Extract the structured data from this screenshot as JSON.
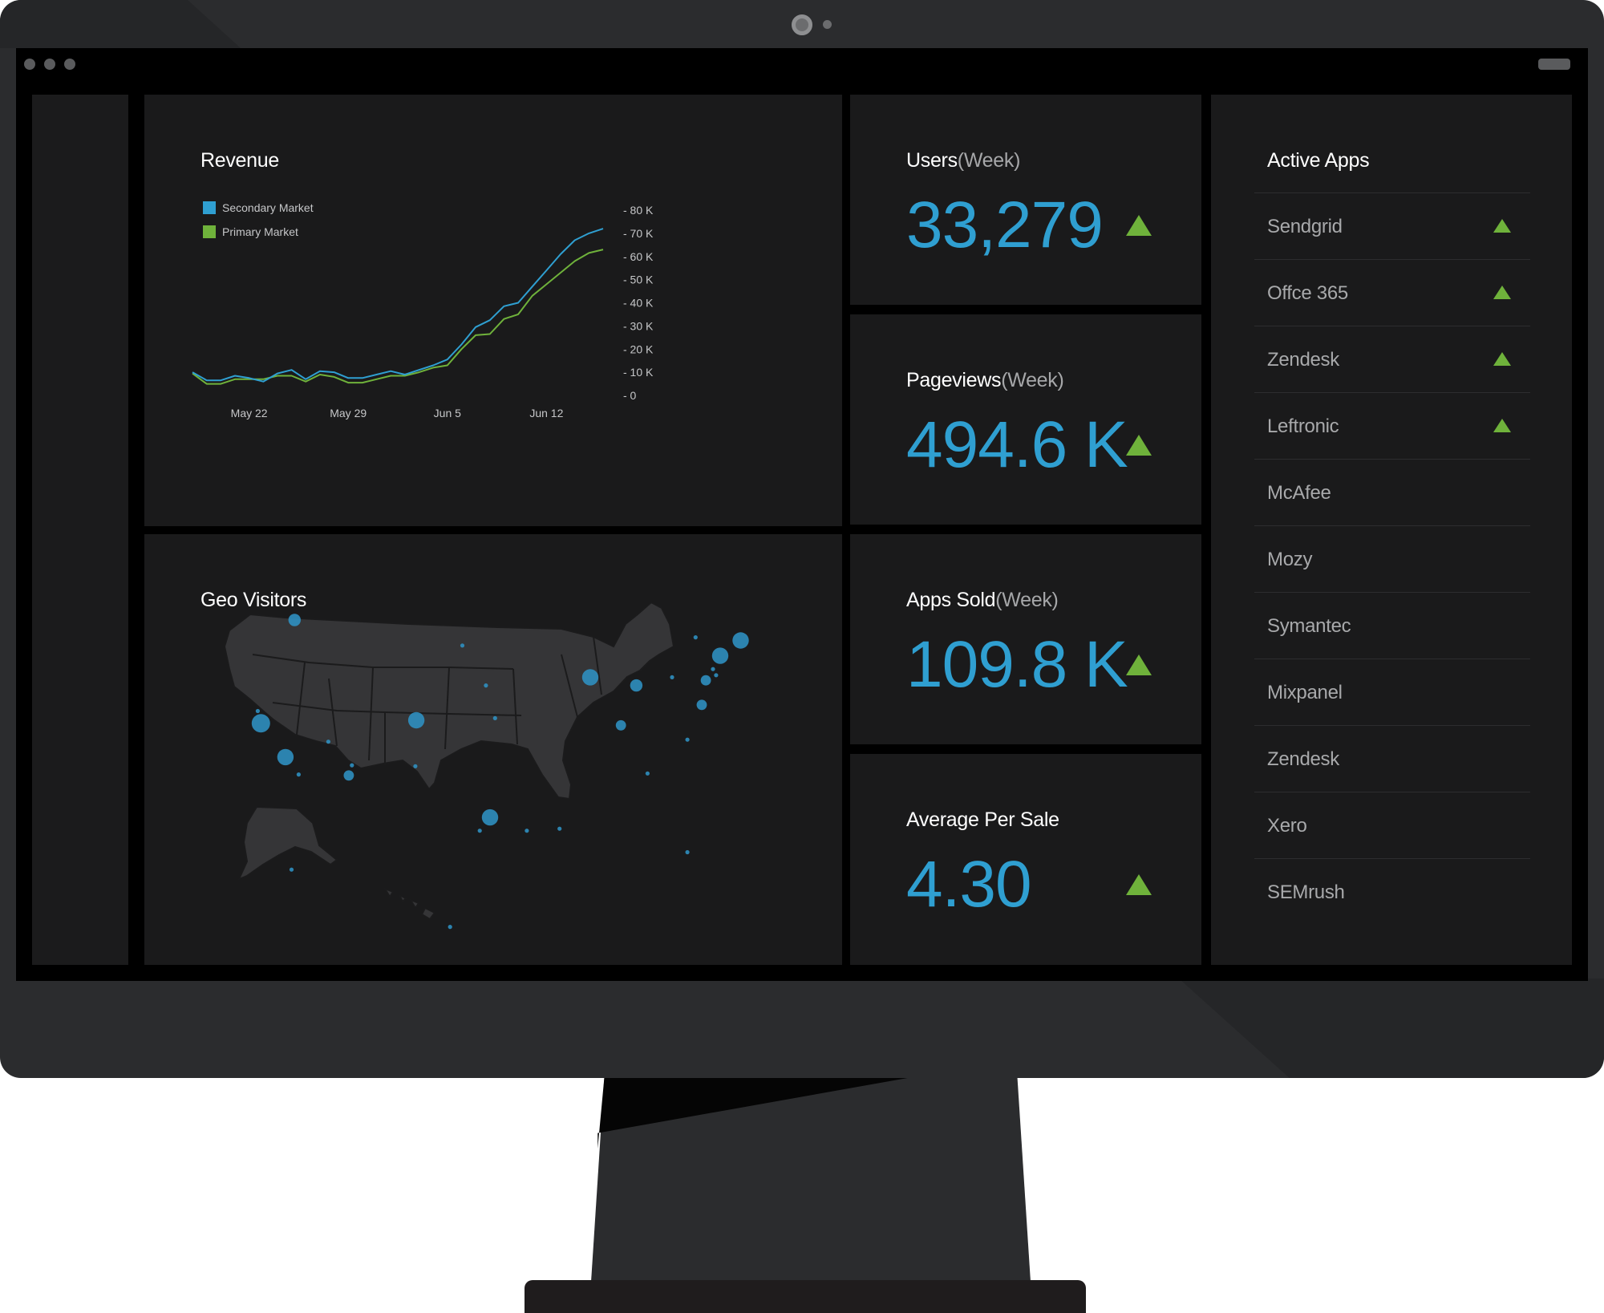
{
  "revenue": {
    "title": "Revenue",
    "legend": [
      {
        "label": "Secondary Market",
        "color": "#2f9fd1"
      },
      {
        "label": "Primary Market",
        "color": "#6fb23b"
      }
    ]
  },
  "chart_data": {
    "type": "line",
    "title": "Revenue",
    "x_ticks": [
      "May 22",
      "May 29",
      "Jun 5",
      "Jun 12"
    ],
    "y_ticks": [
      "- 80 K",
      "- 70 K",
      "- 60 K",
      "- 50 K",
      "- 40 K",
      "- 30 K",
      "- 20 K",
      "- 10 K",
      "- 0"
    ],
    "ylim": [
      0,
      80000
    ],
    "grid": false,
    "legend_position": "top-left",
    "x": [
      "May 18",
      "May 19",
      "May 20",
      "May 21",
      "May 22",
      "May 23",
      "May 24",
      "May 25",
      "May 26",
      "May 27",
      "May 28",
      "May 29",
      "May 30",
      "May 31",
      "Jun 1",
      "Jun 2",
      "Jun 3",
      "Jun 4",
      "Jun 5",
      "Jun 6",
      "Jun 7",
      "Jun 8",
      "Jun 9",
      "Jun 10",
      "Jun 11",
      "Jun 12",
      "Jun 13",
      "Jun 14",
      "Jun 15",
      "Jun 16"
    ],
    "series": [
      {
        "name": "Secondary Market",
        "color": "#2f9fd1",
        "values": [
          10000,
          6500,
          6500,
          8500,
          7500,
          6000,
          9500,
          11000,
          7000,
          10500,
          10000,
          7500,
          7500,
          9000,
          10500,
          9000,
          11000,
          13000,
          15500,
          22000,
          29500,
          32500,
          38500,
          40000,
          47000,
          54000,
          61000,
          67000,
          70000,
          72000
        ]
      },
      {
        "name": "Primary Market",
        "color": "#6fb23b",
        "values": [
          9500,
          5000,
          5000,
          7000,
          7000,
          7000,
          8500,
          8500,
          6000,
          9000,
          8000,
          5500,
          5500,
          7000,
          8500,
          8500,
          10000,
          12000,
          13000,
          20000,
          26000,
          26500,
          33000,
          35000,
          43000,
          48000,
          53000,
          58000,
          61500,
          63000
        ]
      }
    ]
  },
  "geo": {
    "title": "Geo Visitors",
    "bubbles": [
      {
        "x": 288,
        "y": 606,
        "r": 6
      },
      {
        "x": 255,
        "y": 707,
        "r": 9
      },
      {
        "x": 279,
        "y": 740,
        "r": 8
      },
      {
        "x": 407,
        "y": 704,
        "r": 8
      },
      {
        "x": 577,
        "y": 662,
        "r": 8
      },
      {
        "x": 622,
        "y": 670,
        "r": 6
      },
      {
        "x": 607,
        "y": 709,
        "r": 5
      },
      {
        "x": 704,
        "y": 641,
        "r": 8
      },
      {
        "x": 724,
        "y": 626,
        "r": 8
      },
      {
        "x": 690,
        "y": 665,
        "r": 5
      },
      {
        "x": 686,
        "y": 689,
        "r": 5
      },
      {
        "x": 479,
        "y": 799,
        "r": 8
      },
      {
        "x": 341,
        "y": 758,
        "r": 5
      },
      {
        "x": 452,
        "y": 631,
        "r": 2
      },
      {
        "x": 475,
        "y": 670,
        "r": 2
      },
      {
        "x": 484,
        "y": 702,
        "r": 2
      },
      {
        "x": 406,
        "y": 749,
        "r": 2
      },
      {
        "x": 344,
        "y": 748,
        "r": 2
      },
      {
        "x": 321,
        "y": 725,
        "r": 2
      },
      {
        "x": 292,
        "y": 757,
        "r": 2
      },
      {
        "x": 633,
        "y": 756,
        "r": 2
      },
      {
        "x": 672,
        "y": 723,
        "r": 2
      },
      {
        "x": 657,
        "y": 662,
        "r": 2
      },
      {
        "x": 680,
        "y": 623,
        "r": 2
      },
      {
        "x": 515,
        "y": 812,
        "r": 2
      },
      {
        "x": 547,
        "y": 810,
        "r": 2
      },
      {
        "x": 672,
        "y": 833,
        "r": 2
      },
      {
        "x": 469,
        "y": 812,
        "r": 2
      },
      {
        "x": 285,
        "y": 850,
        "r": 2
      },
      {
        "x": 440,
        "y": 906,
        "r": 2
      },
      {
        "x": 252,
        "y": 695,
        "r": 2
      },
      {
        "x": 697,
        "y": 654,
        "r": 2
      },
      {
        "x": 700,
        "y": 660,
        "r": 2
      }
    ]
  },
  "kpis": [
    {
      "label": "Users",
      "sub": "(Week)",
      "value": "33,279"
    },
    {
      "label": "Pageviews",
      "sub": "(Week)",
      "value": "494.6 K"
    },
    {
      "label": "Apps Sold",
      "sub": "(Week)",
      "value": "109.8 K"
    },
    {
      "label": "Average Per Sale",
      "sub": "",
      "value": "4.30"
    }
  ],
  "apps": {
    "title": "Active Apps",
    "items": [
      {
        "name": "Sendgrid",
        "up": true
      },
      {
        "name": "Offce 365",
        "up": true
      },
      {
        "name": "Zendesk",
        "up": true
      },
      {
        "name": "Leftronic",
        "up": true
      },
      {
        "name": "McAfee",
        "up": false
      },
      {
        "name": "Mozy",
        "up": false
      },
      {
        "name": "Symantec",
        "up": false
      },
      {
        "name": "Mixpanel",
        "up": false
      },
      {
        "name": "Zendesk",
        "up": false
      },
      {
        "name": "Xero",
        "up": false
      },
      {
        "name": "SEMrush",
        "up": false
      }
    ]
  },
  "colors": {
    "accent": "#2f9fd1",
    "up": "#6fb23b",
    "panel": "#1a1a1b"
  }
}
